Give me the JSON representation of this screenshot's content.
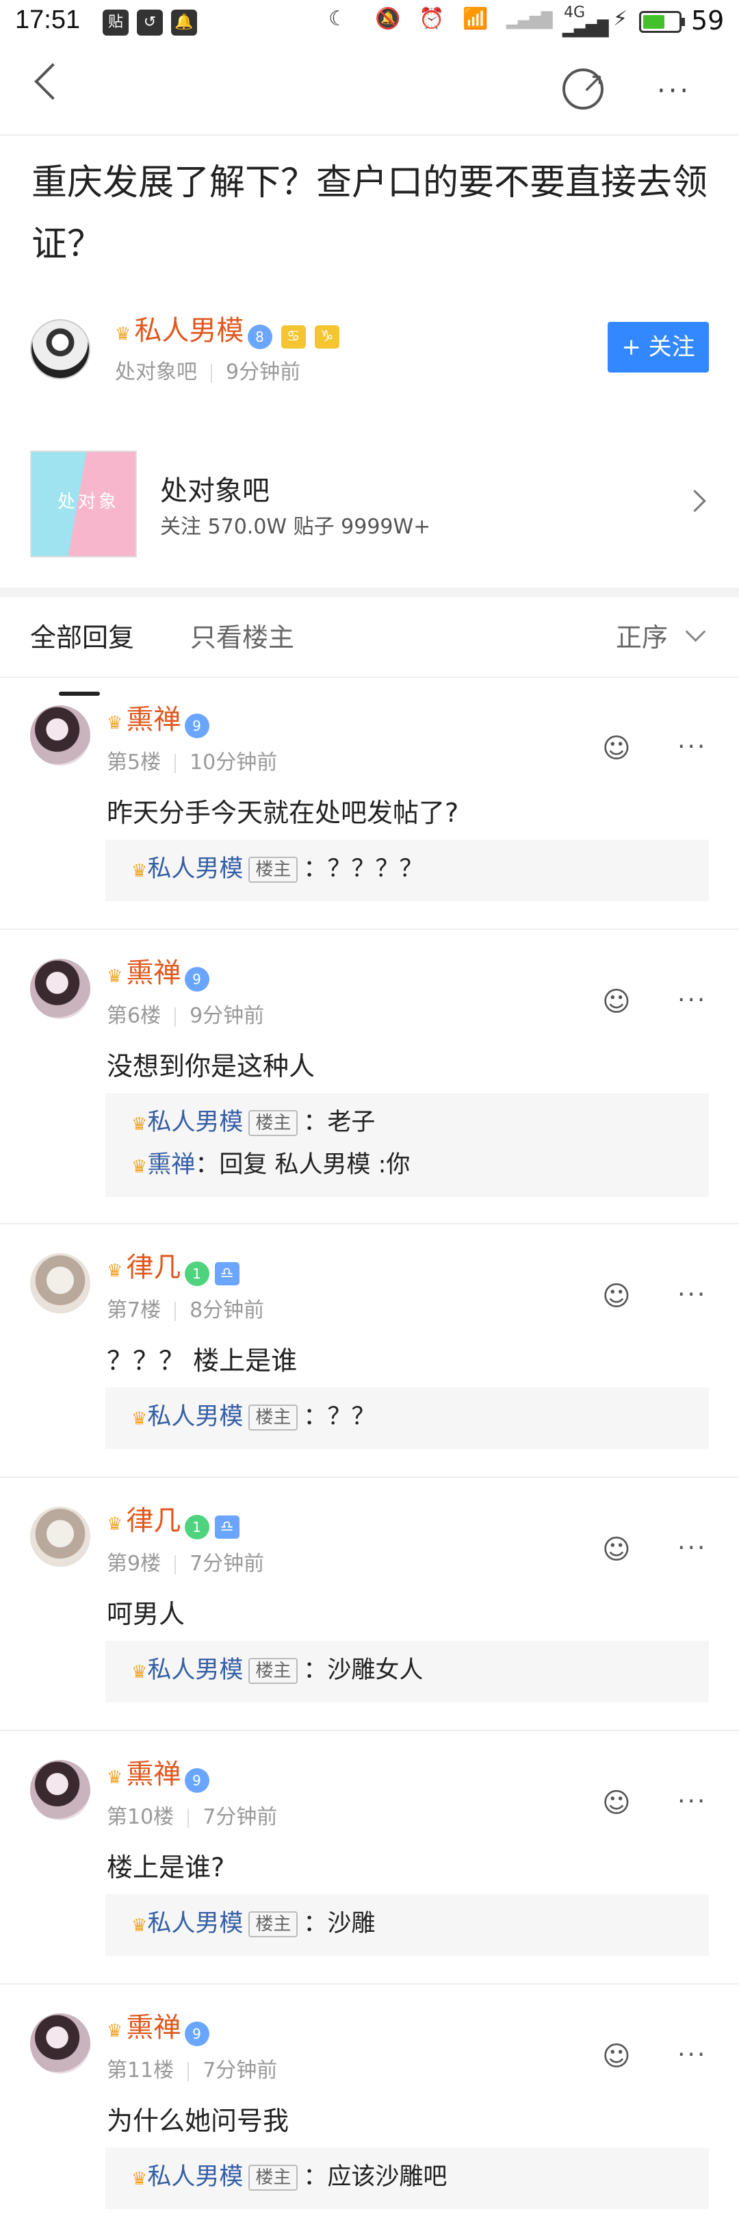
{
  "status_bar": {
    "time": "17:51",
    "left_icons": [
      "贴",
      "↺",
      "🔔"
    ],
    "right_icons": [
      "☾",
      "🔕",
      "⏰",
      "📶",
      "4G",
      "⚡"
    ],
    "battery": "59",
    "battery_level": 0.59,
    "battery_color": "#43c12c"
  },
  "nav": {
    "back": "back-icon",
    "share": "share-icon",
    "more": "···"
  },
  "title": "重庆发展了解下？查户口的要不要直接去领证？",
  "author": {
    "name": "私人男模",
    "level": "8",
    "zodiac": [
      "♋",
      "♑"
    ],
    "forum": "处对象吧",
    "time": "9分钟前",
    "follow": "+ 关注"
  },
  "forum": {
    "name": "处对象吧",
    "img_text": "处对象",
    "stats": "关注 570.0W    贴子 9999W+"
  },
  "tabs": {
    "all": "全部回复",
    "lz_only": "只看楼主",
    "sort": "正序"
  },
  "posts": [
    {
      "name": "熏禅",
      "level": "9",
      "floor": "第5楼",
      "time": "10分钟前",
      "content": "昨天分手今天就在处吧发帖了?",
      "replies": [
        {
          "name": "私人男模",
          "lz": "楼主",
          "text": "：？？？？"
        }
      ]
    },
    {
      "name": "熏禅",
      "level": "9",
      "floor": "第6楼",
      "time": "9分钟前",
      "content": "没想到你是这种人",
      "replies": [
        {
          "name": "私人男模",
          "lz": "楼主",
          "text": "：老子"
        },
        {
          "name": "熏禅",
          "text": "：回复 私人男模 :你"
        }
      ]
    },
    {
      "name": "律几",
      "level": "1",
      "zodiac": "♎",
      "floor": "第7楼",
      "time": "8分钟前",
      "content": "？？？ 楼上是谁",
      "replies": [
        {
          "name": "私人男模",
          "lz": "楼主",
          "text": "：？？"
        }
      ]
    },
    {
      "name": "律几",
      "level": "1",
      "zodiac": "♎",
      "floor": "第9楼",
      "time": "7分钟前",
      "content": "呵男人",
      "replies": [
        {
          "name": "私人男模",
          "lz": "楼主",
          "text": "：沙雕女人"
        }
      ]
    },
    {
      "name": "熏禅",
      "level": "9",
      "floor": "第10楼",
      "time": "7分钟前",
      "content": "楼上是谁?",
      "replies": [
        {
          "name": "私人男模",
          "lz": "楼主",
          "text": "：沙雕"
        }
      ]
    },
    {
      "name": "熏禅",
      "level": "9",
      "floor": "第11楼",
      "time": "7分钟前",
      "content": "为什么她问号我",
      "replies": [
        {
          "name": "私人男模",
          "lz": "楼主",
          "text": "：应该沙雕吧"
        }
      ]
    }
  ]
}
